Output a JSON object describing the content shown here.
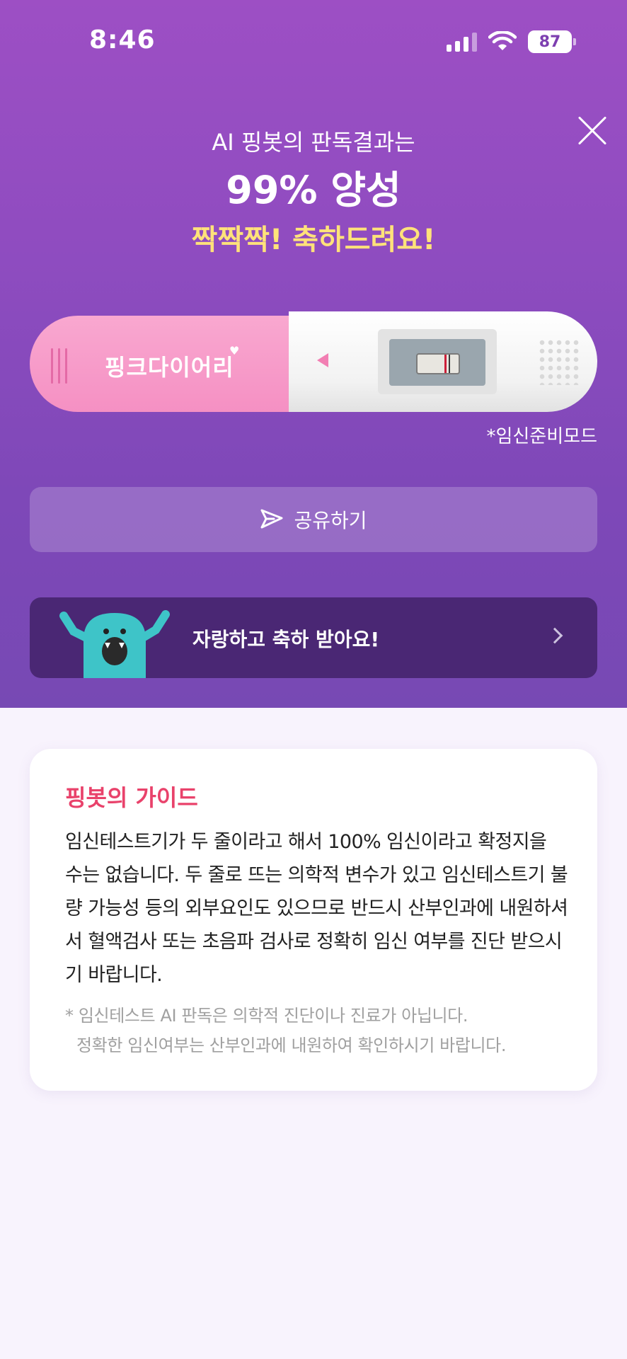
{
  "status_bar": {
    "time": "8:46",
    "battery": "87"
  },
  "result": {
    "intro": "AI 핑봇의 판독결과는",
    "value": "99% 양성",
    "congrats": "짝짝짝! 축하드려요!"
  },
  "test_stick": {
    "brand": "핑크다이어리",
    "mode_note": "*임신준비모드"
  },
  "share": {
    "label": "공유하기"
  },
  "banner": {
    "text": "자랑하고 축하 받아요!"
  },
  "guide": {
    "title": "핑봇의 가이드",
    "body": "임신테스트기가 두 줄이라고 해서 100% 임신이라고 확정지을 수는 없습니다. 두 줄로 뜨는 의학적 변수가 있고 임신테스트기 불량 가능성 등의 외부요인도 있으므로 반드시 산부인과에 내원하셔서 혈액검사 또는 초음파 검사로 정확히 임신 여부를 진단 받으시기 바랍니다.",
    "note_line1": "* 임신테스트 AI 판독은 의학적 진단이나 진료가 아닙니다.",
    "note_line2": "정확한 임신여부는 산부인과에 내원하여 확인하시기 바랍니다."
  },
  "colors": {
    "hero_top": "#9d4fc4",
    "hero_bottom": "#7749b4",
    "congrats": "#ffe27a",
    "guide_title": "#e9426b",
    "banner_bg": "#4a2774"
  },
  "icons": [
    "signal-icon",
    "wifi-icon",
    "battery-icon",
    "close-icon",
    "send-icon",
    "chevron-right-icon",
    "mascot-icon"
  ]
}
